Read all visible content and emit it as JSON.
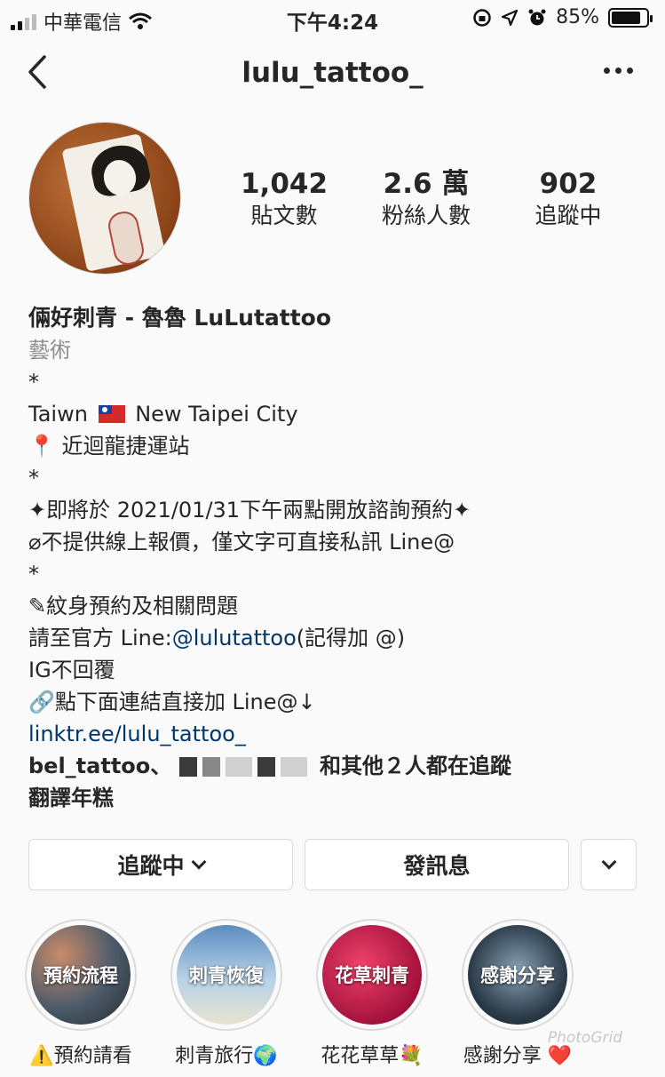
{
  "status_bar": {
    "carrier": "中華電信",
    "time": "下午4:24",
    "battery_text": "85%",
    "battery_level": 0.85
  },
  "nav": {
    "title": "lulu_tattoo_"
  },
  "stats": [
    {
      "value": "1,042",
      "label": "貼文數"
    },
    {
      "value": "2.6 萬",
      "label": "粉絲人數"
    },
    {
      "value": "902",
      "label": "追蹤中"
    }
  ],
  "bio": {
    "name": "倆好刺青 - 魯魯 LuLutattoo",
    "category": "藝術",
    "star1": "*",
    "location_a": "Taiwn",
    "location_b": "New Taipei City",
    "pin_line": "近迴龍捷運站",
    "star2": "*",
    "announce": "✦即將於 2021/01/31下午兩點開放諮詢預約✦",
    "no_quote": "⌀不提供線上報價，僅文字可直接私訊 Line@",
    "star3": "*",
    "booking": "✎紋身預約及相關問題",
    "line_prefix": "請至官方 Line:",
    "line_handle": "@lulutattoo",
    "line_suffix": "(記得加 @)",
    "ig_note": "IG不回覆",
    "link_note": "點下面連結直接加 Line@↓",
    "link": "linktr.ee/lulu_tattoo_",
    "followed_by_name": "bel_tattoo",
    "followed_by_sep": "、",
    "followed_by_tail": "和其他２人都在追蹤",
    "translate": "翻譯年糕"
  },
  "buttons": {
    "following": "追蹤中",
    "message": "發訊息"
  },
  "highlights": [
    {
      "cover": "預約流程",
      "label": "⚠️預約請看"
    },
    {
      "cover": "刺青恢復",
      "label": "刺青旅行🌍"
    },
    {
      "cover": "花草刺青",
      "label": "花花草草💐"
    },
    {
      "cover": "感謝分享",
      "label": "感謝分享 ❤️"
    }
  ],
  "watermark": "PhotoGrid"
}
